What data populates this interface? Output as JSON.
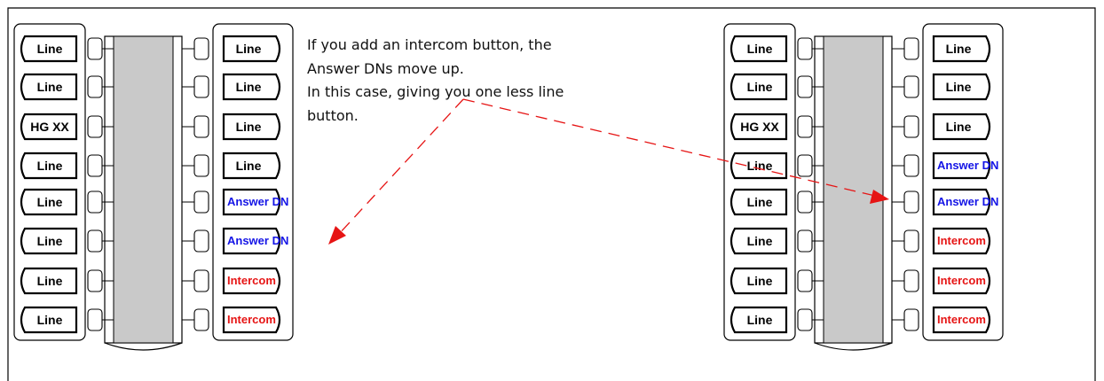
{
  "colors": {
    "stroke": "#000000",
    "panel_fill": "#c9c9c9",
    "answer_dn": "#1414e6",
    "intercom": "#e61414",
    "arrow": "#e61414",
    "label": "#000000"
  },
  "annotation": {
    "lines": [
      "If you add an intercom button, the",
      "Answer DNs move up.",
      "In this case, giving you one less line",
      "button."
    ]
  },
  "before_module": {
    "left_keys": [
      {
        "label": "Line"
      },
      {
        "label": "Line"
      },
      {
        "label": "HG XX"
      },
      {
        "label": "Line"
      },
      {
        "label": "Line"
      },
      {
        "label": "Line"
      },
      {
        "label": "Line"
      },
      {
        "label": "Line"
      }
    ],
    "right_keys": [
      {
        "label": "Line",
        "kind": "line"
      },
      {
        "label": "Line",
        "kind": "line"
      },
      {
        "label": "Line",
        "kind": "line"
      },
      {
        "label": "Line",
        "kind": "line"
      },
      {
        "label": "Answer DN",
        "kind": "answer"
      },
      {
        "label": "Answer DN",
        "kind": "answer"
      },
      {
        "label": "Intercom",
        "kind": "intercom"
      },
      {
        "label": "Intercom",
        "kind": "intercom"
      }
    ]
  },
  "after_module": {
    "left_keys": [
      {
        "label": "Line"
      },
      {
        "label": "Line"
      },
      {
        "label": "HG XX"
      },
      {
        "label": "Line"
      },
      {
        "label": "Line"
      },
      {
        "label": "Line"
      },
      {
        "label": "Line"
      },
      {
        "label": "Line"
      }
    ],
    "right_keys": [
      {
        "label": "Line",
        "kind": "line"
      },
      {
        "label": "Line",
        "kind": "line"
      },
      {
        "label": "Line",
        "kind": "line"
      },
      {
        "label": "Answer DN",
        "kind": "answer"
      },
      {
        "label": "Answer DN",
        "kind": "answer"
      },
      {
        "label": "Intercom",
        "kind": "intercom"
      },
      {
        "label": "Intercom",
        "kind": "intercom"
      },
      {
        "label": "Intercom",
        "kind": "intercom"
      }
    ]
  }
}
